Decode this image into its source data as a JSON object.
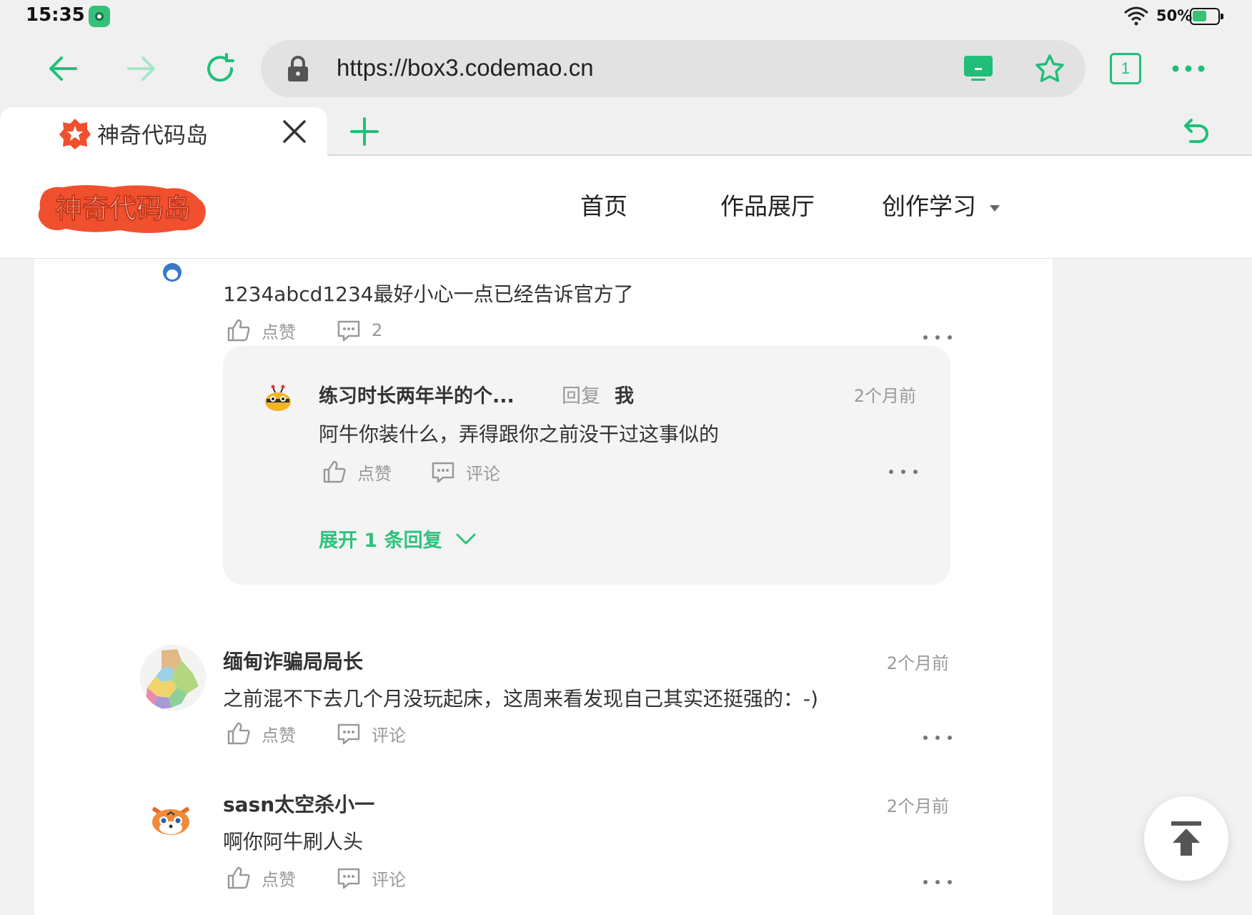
{
  "status_bar": {
    "time": "15:35",
    "battery": "50%",
    "battery_level": 0.5
  },
  "browser": {
    "url": "https://box3.codemao.cn",
    "tab_count": "1",
    "tab_title": "神奇代码岛",
    "accent_color": "#1fbf7a"
  },
  "site": {
    "logo_text": "神奇代码岛",
    "nav": {
      "home": "首页",
      "gallery": "作品展厅",
      "learn": "创作学习"
    }
  },
  "comments": {
    "first": {
      "text": "1234abcd1234最好小心一点已经告诉官方了",
      "like_label": "点赞",
      "reply_count": "2"
    },
    "reply": {
      "author": "练习时长两年半的个...",
      "reply_word": "回复",
      "target": "我",
      "time": "2个月前",
      "text": "阿牛你装什么，弄得跟你之前没干过这事似的",
      "like_label": "点赞",
      "comment_label": "评论",
      "expand_label": "展开 1 条回复"
    },
    "second": {
      "author": "缅甸诈骗局局长",
      "time": "2个月前",
      "text": "之前混不下去几个月没玩起床，这周来看发现自己其实还挺强的：-)",
      "like_label": "点赞",
      "comment_label": "评论"
    },
    "third": {
      "author": "sasn太空杀小一",
      "time": "2个月前",
      "text": "啊你阿牛刷人头",
      "like_label": "点赞",
      "comment_label": "评论"
    }
  }
}
